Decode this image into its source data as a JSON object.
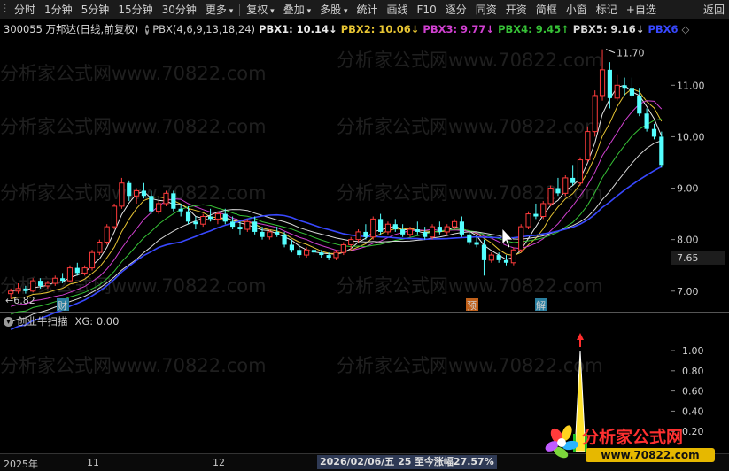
{
  "toolbar": {
    "items": [
      "分时",
      "1分钟",
      "5分钟",
      "15分钟",
      "30分钟",
      "更多",
      "复权",
      "叠加",
      "多股",
      "统计",
      "画线",
      "F10",
      "逐分",
      "同资",
      "开资",
      "简框",
      "小窗",
      "标记",
      "+自选",
      "返回"
    ]
  },
  "info": {
    "stock": "300055 万邦达(日线,前复权)",
    "indicator": "PBX(4,6,9,13,18,24)",
    "pbx": [
      {
        "label": "PBX1: 10.14",
        "arrow": "↓",
        "color": "#e8e8e8"
      },
      {
        "label": "PBX2: 10.06",
        "arrow": "↓",
        "color": "#e6c433"
      },
      {
        "label": "PBX3: 9.77",
        "arrow": "↓",
        "color": "#d040d0"
      },
      {
        "label": "PBX4: 9.45",
        "arrow": "↑",
        "color": "#36c136"
      },
      {
        "label": "PBX5: 9.16",
        "arrow": "↓",
        "color": "#d8d8d8"
      },
      {
        "label": "PBX6",
        "arrow": "",
        "color": "#3848ff"
      }
    ]
  },
  "indicator_panel": {
    "title": "创业牛扫描",
    "value": "XG: 0.00"
  },
  "price_axis": {
    "ticks": [
      "11.00",
      "10.00",
      "9.00",
      "8.00",
      "7.00"
    ],
    "current": "7.65"
  },
  "indicator_axis": {
    "ticks": [
      "1.00",
      "0.80",
      "0.60",
      "0.40",
      "0.20"
    ]
  },
  "annotations": {
    "high": "11.70",
    "low": "6.82",
    "markers": [
      "财",
      "预",
      "解"
    ]
  },
  "status_bar": {
    "year": "2025年",
    "m1": "11",
    "m2": "12",
    "date": "2026/02/06/五 25",
    "change": "至今涨幅27.57%"
  },
  "watermark": "分析家公式网www.70822.com",
  "logo": {
    "text": "分析家公式网",
    "url": "www.70822.com"
  },
  "colors": {
    "up": "#ff3b3b",
    "down": "#54ffff",
    "pbx1": "#e8e8e8",
    "pbx2": "#e6c433",
    "pbx3": "#d040d0",
    "pbx4": "#36c136",
    "pbx5": "#d8d8d8",
    "pbx6": "#3848ff"
  },
  "chart_data": {
    "type": "candlestick",
    "ylim": [
      6.6,
      11.9
    ],
    "candles": [
      [
        6.95,
        7.05,
        6.85,
        7.0
      ],
      [
        7.0,
        7.15,
        6.95,
        7.05
      ],
      [
        7.05,
        7.1,
        6.95,
        7.0
      ],
      [
        7.0,
        7.25,
        6.98,
        7.2
      ],
      [
        7.2,
        7.25,
        7.05,
        7.1
      ],
      [
        7.1,
        7.2,
        7.05,
        7.15
      ],
      [
        7.15,
        7.3,
        7.1,
        7.25
      ],
      [
        7.25,
        7.35,
        7.15,
        7.2
      ],
      [
        7.2,
        7.5,
        7.18,
        7.45
      ],
      [
        7.45,
        7.55,
        7.3,
        7.35
      ],
      [
        7.35,
        7.5,
        7.3,
        7.45
      ],
      [
        7.45,
        7.8,
        7.4,
        7.75
      ],
      [
        7.75,
        8.0,
        7.7,
        7.95
      ],
      [
        7.95,
        8.3,
        7.9,
        8.25
      ],
      [
        8.25,
        8.7,
        8.2,
        8.65
      ],
      [
        8.65,
        9.2,
        8.6,
        9.1
      ],
      [
        9.1,
        9.15,
        8.75,
        8.85
      ],
      [
        8.85,
        9.0,
        8.7,
        8.95
      ],
      [
        8.95,
        9.1,
        8.8,
        8.85
      ],
      [
        8.85,
        8.95,
        8.5,
        8.55
      ],
      [
        8.55,
        8.75,
        8.5,
        8.7
      ],
      [
        8.7,
        8.95,
        8.65,
        8.9
      ],
      [
        8.9,
        8.95,
        8.55,
        8.6
      ],
      [
        8.6,
        8.7,
        8.45,
        8.55
      ],
      [
        8.55,
        8.65,
        8.3,
        8.35
      ],
      [
        8.35,
        8.45,
        8.2,
        8.3
      ],
      [
        8.3,
        8.5,
        8.25,
        8.45
      ],
      [
        8.45,
        8.6,
        8.35,
        8.4
      ],
      [
        8.4,
        8.55,
        8.3,
        8.5
      ],
      [
        8.5,
        8.6,
        8.3,
        8.35
      ],
      [
        8.35,
        8.45,
        8.2,
        8.25
      ],
      [
        8.25,
        8.35,
        8.1,
        8.2
      ],
      [
        8.2,
        8.4,
        8.15,
        8.35
      ],
      [
        8.35,
        8.45,
        8.1,
        8.15
      ],
      [
        8.15,
        8.25,
        8.0,
        8.05
      ],
      [
        8.05,
        8.2,
        8.0,
        8.15
      ],
      [
        8.15,
        8.25,
        8.05,
        8.1
      ],
      [
        8.1,
        8.15,
        7.85,
        7.9
      ],
      [
        7.9,
        8.0,
        7.75,
        7.8
      ],
      [
        7.8,
        7.9,
        7.65,
        7.7
      ],
      [
        7.7,
        7.85,
        7.65,
        7.8
      ],
      [
        7.8,
        7.9,
        7.7,
        7.75
      ],
      [
        7.75,
        7.8,
        7.65,
        7.7
      ],
      [
        7.7,
        7.75,
        7.6,
        7.65
      ],
      [
        7.65,
        7.8,
        7.6,
        7.75
      ],
      [
        7.75,
        7.95,
        7.7,
        7.9
      ],
      [
        7.9,
        8.05,
        7.8,
        8.0
      ],
      [
        8.0,
        8.2,
        7.95,
        8.15
      ],
      [
        8.15,
        8.3,
        8.0,
        8.05
      ],
      [
        8.05,
        8.45,
        8.0,
        8.4
      ],
      [
        8.4,
        8.5,
        8.1,
        8.15
      ],
      [
        8.15,
        8.35,
        8.1,
        8.3
      ],
      [
        8.3,
        8.4,
        8.15,
        8.2
      ],
      [
        8.2,
        8.3,
        8.05,
        8.1
      ],
      [
        8.1,
        8.25,
        8.05,
        8.2
      ],
      [
        8.2,
        8.35,
        8.1,
        8.15
      ],
      [
        8.15,
        8.25,
        8.0,
        8.05
      ],
      [
        8.05,
        8.3,
        8.0,
        8.25
      ],
      [
        8.25,
        8.35,
        8.1,
        8.15
      ],
      [
        8.15,
        8.3,
        8.1,
        8.25
      ],
      [
        8.25,
        8.4,
        8.2,
        8.35
      ],
      [
        8.35,
        8.45,
        8.05,
        8.1
      ],
      [
        8.1,
        8.15,
        7.9,
        7.95
      ],
      [
        7.95,
        8.05,
        7.85,
        7.9
      ],
      [
        7.9,
        8.0,
        7.3,
        7.6
      ],
      [
        7.6,
        7.75,
        7.55,
        7.7
      ],
      [
        7.7,
        7.75,
        7.55,
        7.6
      ],
      [
        7.6,
        7.7,
        7.5,
        7.55
      ],
      [
        7.55,
        7.85,
        7.5,
        7.8
      ],
      [
        7.8,
        8.3,
        7.75,
        8.25
      ],
      [
        8.25,
        8.55,
        8.2,
        8.5
      ],
      [
        8.5,
        8.7,
        8.4,
        8.45
      ],
      [
        8.45,
        8.75,
        8.4,
        8.7
      ],
      [
        8.7,
        9.05,
        8.65,
        9.0
      ],
      [
        9.0,
        9.2,
        8.85,
        8.9
      ],
      [
        8.9,
        9.25,
        8.85,
        9.2
      ],
      [
        9.2,
        9.45,
        9.05,
        9.1
      ],
      [
        9.1,
        9.6,
        9.05,
        9.55
      ],
      [
        9.55,
        10.2,
        9.5,
        10.1
      ],
      [
        10.1,
        10.9,
        10.0,
        10.8
      ],
      [
        10.8,
        11.7,
        10.7,
        11.3
      ],
      [
        11.3,
        11.45,
        10.55,
        10.75
      ],
      [
        10.75,
        11.2,
        10.7,
        11.0
      ],
      [
        11.0,
        11.15,
        10.8,
        10.95
      ],
      [
        10.95,
        11.15,
        10.75,
        10.8
      ],
      [
        10.8,
        10.95,
        10.4,
        10.45
      ],
      [
        10.45,
        10.55,
        10.1,
        10.15
      ],
      [
        10.15,
        10.25,
        9.95,
        10.0
      ],
      [
        10.0,
        10.1,
        9.4,
        9.45
      ]
    ],
    "signal": {
      "index": 77,
      "value": 1.0
    }
  }
}
